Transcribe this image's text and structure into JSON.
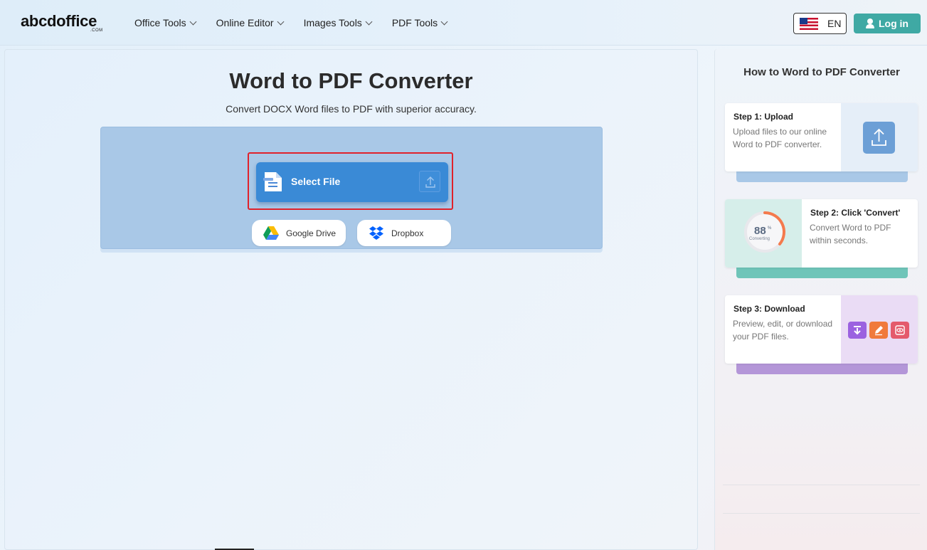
{
  "header": {
    "logo_main": "abcdoffice",
    "logo_sub": ".COM",
    "nav": [
      {
        "label": "Office Tools"
      },
      {
        "label": "Online Editor"
      },
      {
        "label": "Images Tools"
      },
      {
        "label": "PDF Tools"
      }
    ],
    "language": "EN",
    "login_label": "Log in"
  },
  "main": {
    "title": "Word to PDF Converter",
    "subtitle": "Convert DOCX Word files to PDF with superior accuracy.",
    "select_file_label": "Select File",
    "cloud_buttons": {
      "google_drive": "Google Drive",
      "dropbox": "Dropbox"
    }
  },
  "sidebar": {
    "title": "How to Word to PDF Converter",
    "steps": [
      {
        "title": "Step 1: Upload",
        "desc": "Upload files to our online Word to PDF converter."
      },
      {
        "title": "Step 2: Click 'Convert'",
        "desc": "Convert Word to PDF within seconds.",
        "progress_value": "88",
        "progress_unit": "%",
        "progress_label": "Converting"
      },
      {
        "title": "Step 3: Download",
        "desc": "Preview, edit, or download your PDF files."
      }
    ]
  },
  "colors": {
    "accent_teal": "#3fa9a4",
    "button_blue": "#3a8ad6",
    "upload_area": "#a9c8e7",
    "highlight_red": "#e0222b"
  }
}
